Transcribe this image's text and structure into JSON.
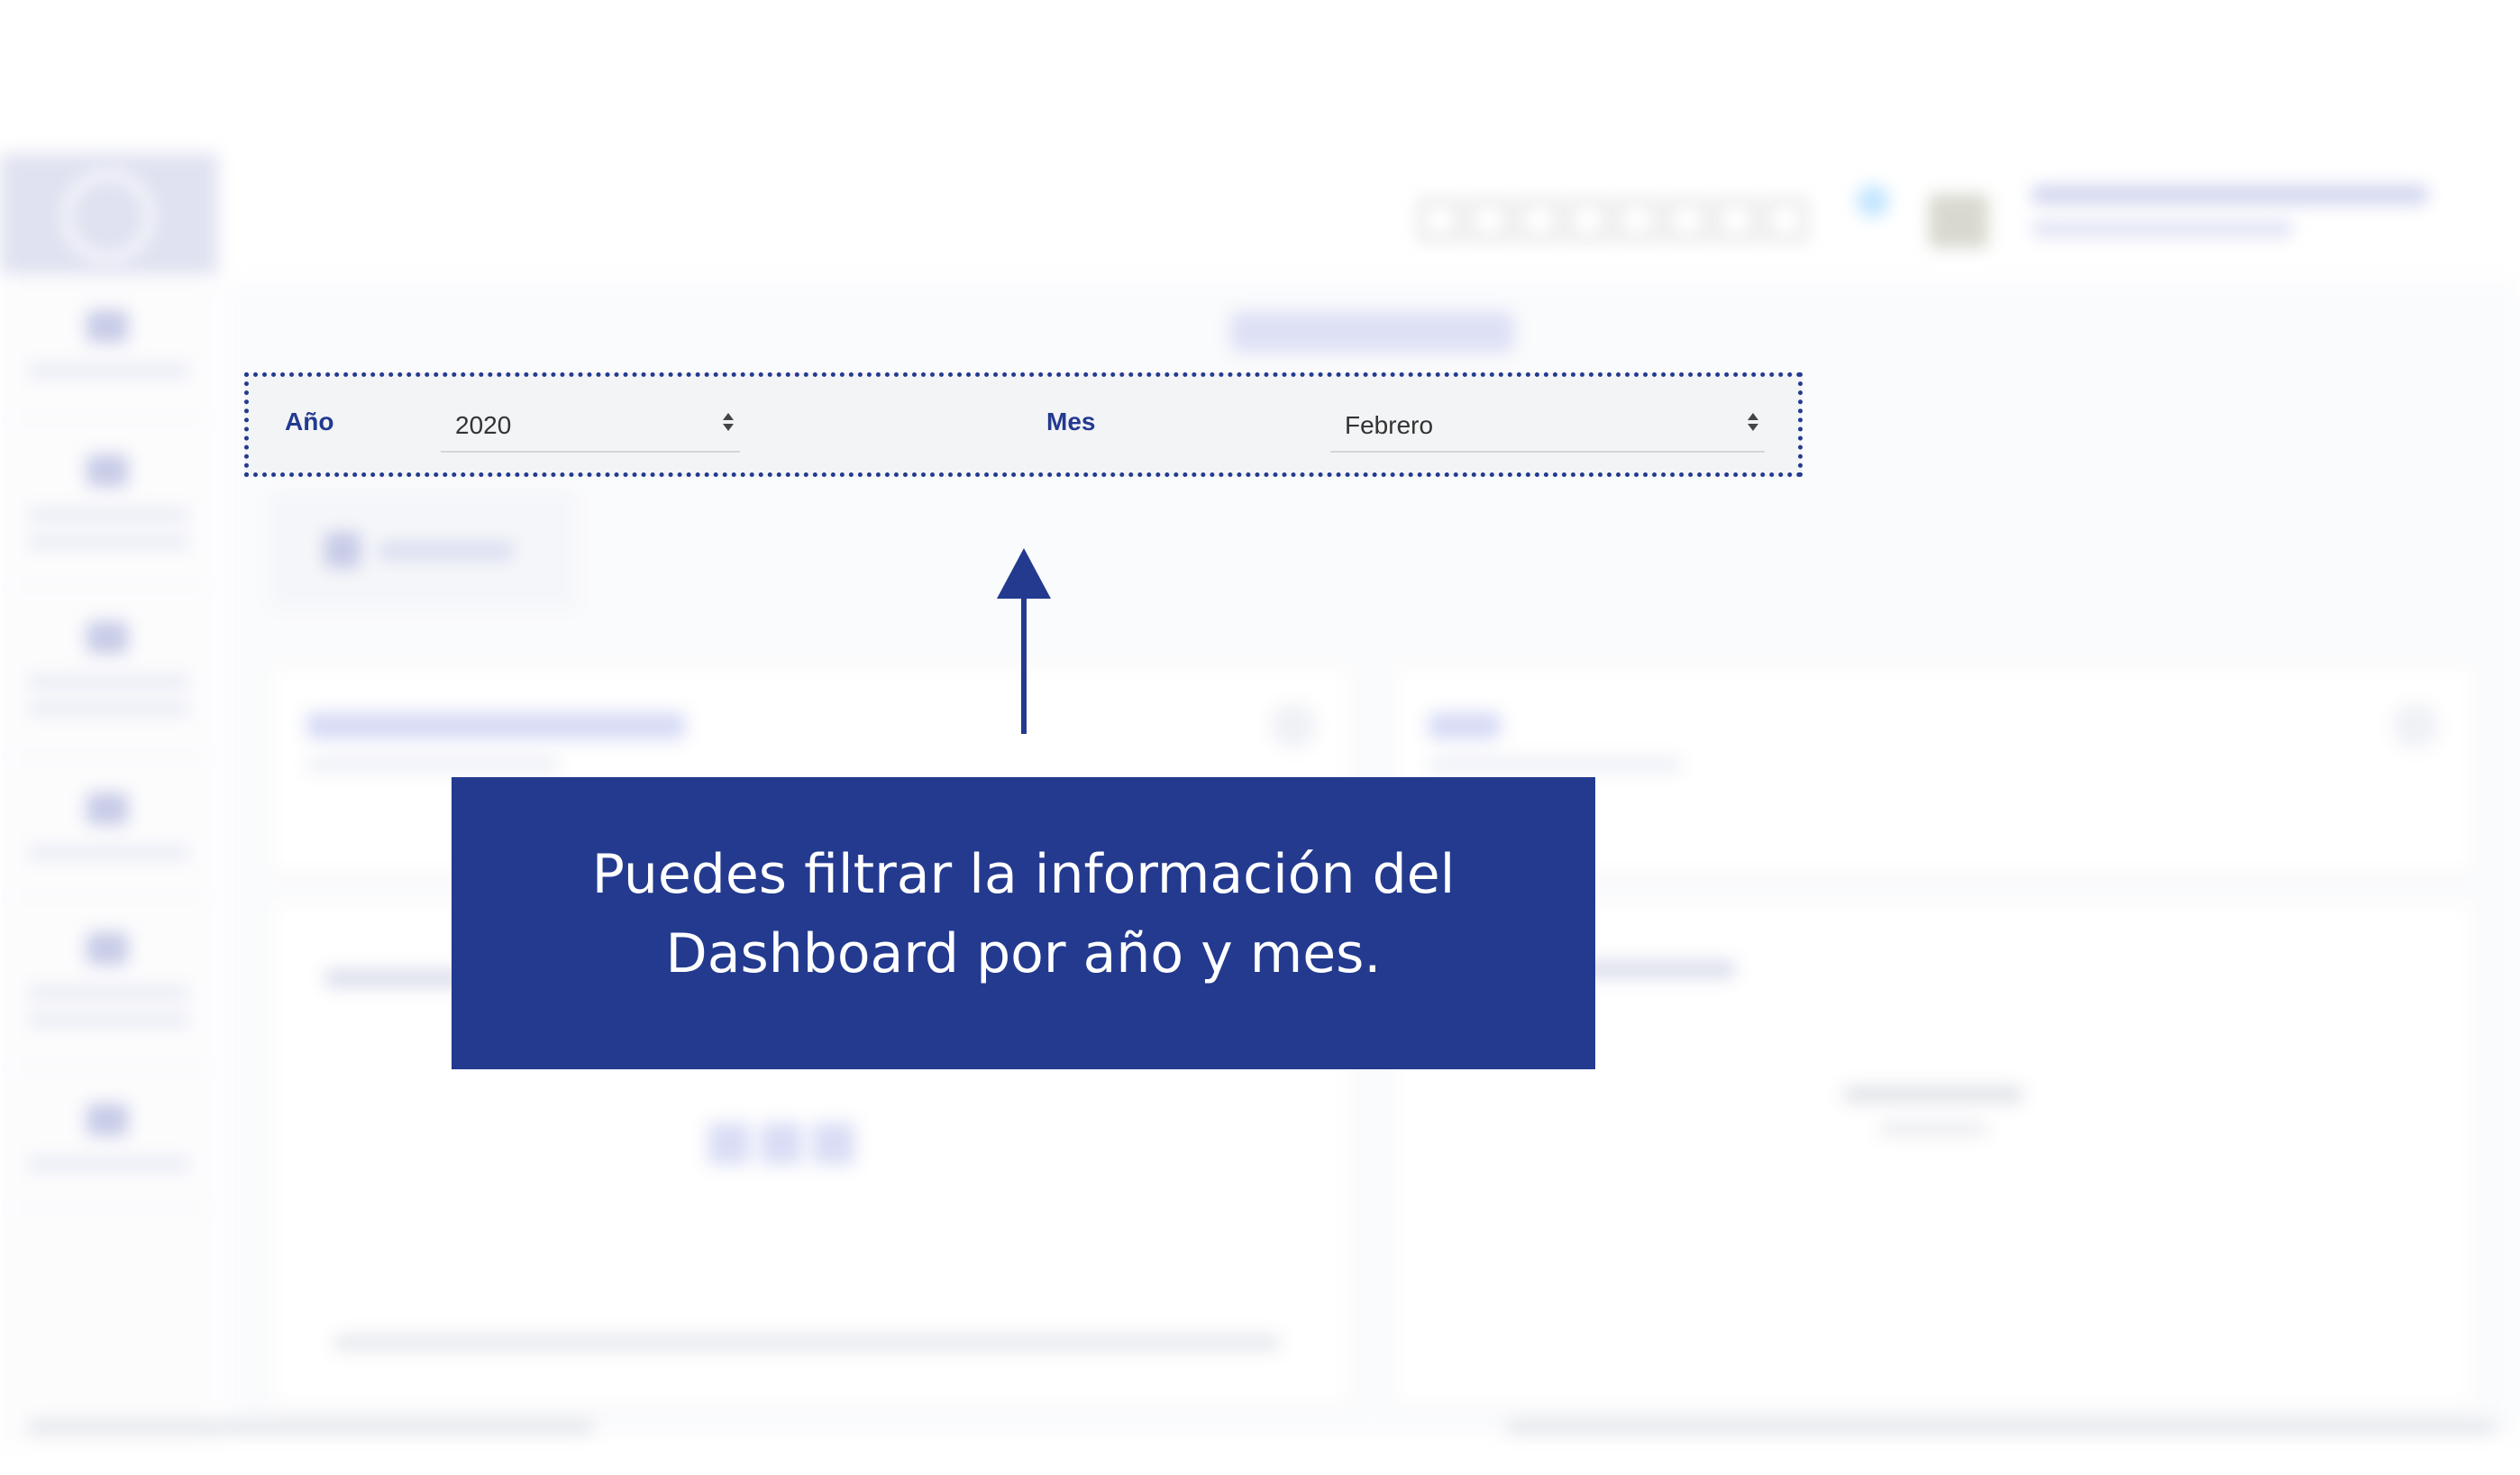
{
  "filters": {
    "year": {
      "label": "Año",
      "value": "2020"
    },
    "month": {
      "label": "Mes",
      "value": "Febrero"
    }
  },
  "callout": {
    "line1": "Puedes filtrar la información del",
    "line2": "Dashboard por año y mes."
  },
  "colors": {
    "accent": "#233a8f",
    "filter_bg": "#f3f4f6"
  },
  "icons": {
    "select_arrows": "up-down-arrows-icon",
    "pointer": "arrow-up-icon"
  }
}
